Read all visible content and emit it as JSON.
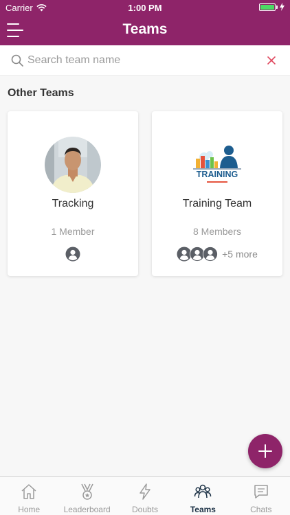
{
  "status_bar": {
    "carrier": "Carrier",
    "time": "1:00 PM",
    "battery_level": 1.0
  },
  "header": {
    "title": "Teams"
  },
  "search": {
    "placeholder": "Search team name",
    "value": ""
  },
  "section_title": "Other Teams",
  "teams": [
    {
      "name": "Tracking",
      "members": "1 Member",
      "extra": ""
    },
    {
      "name": "Training Team",
      "members": "8 Members",
      "extra": "+5 more"
    }
  ],
  "tabs": [
    {
      "label": "Home",
      "icon": "home-icon",
      "active": false
    },
    {
      "label": "Leaderboard",
      "icon": "medal-icon",
      "active": false
    },
    {
      "label": "Doubts",
      "icon": "lightning-icon",
      "active": false
    },
    {
      "label": "Teams",
      "icon": "group-icon",
      "active": true
    },
    {
      "label": "Chats",
      "icon": "chat-icon",
      "active": false
    }
  ],
  "colors": {
    "brand": "#8e2469",
    "active_tab": "#1c3145",
    "clear_x": "#e0475e"
  },
  "training_logo_text": "TRAINING"
}
